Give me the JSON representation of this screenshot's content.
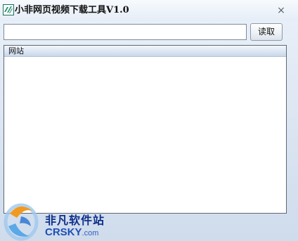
{
  "window": {
    "title": "小非网页视频下载工具V1.0",
    "close_glyph": "×"
  },
  "toolbar": {
    "url_input_value": "",
    "read_label": "读取"
  },
  "list": {
    "columns": [
      "网站"
    ],
    "rows": []
  },
  "watermark": {
    "cn_text": "非凡软件站",
    "en_text": "CRSKY",
    "en_suffix": ".com"
  },
  "icons": {
    "app": "app-icon",
    "close": "close-icon",
    "watermark_logo": "crsky-logo-icon"
  }
}
